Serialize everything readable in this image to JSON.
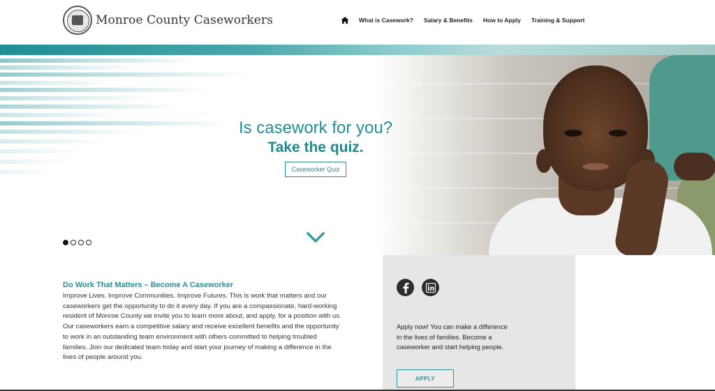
{
  "header": {
    "site_title": "Monroe County Caseworkers",
    "logo_icon": "county-seal-icon",
    "nav": {
      "home_icon": "home-icon",
      "items": [
        {
          "label": "What is Casework?"
        },
        {
          "label": "Salary & Benefits"
        },
        {
          "label": "How to Apply"
        },
        {
          "label": "Training & Support"
        }
      ]
    }
  },
  "hero": {
    "line1": "Is casework for you?",
    "line2": "Take the quiz.",
    "button_label": "Caseworker Quiz",
    "slides_total": 4,
    "active_slide": 1,
    "scroll_icon": "chevron-down-icon"
  },
  "main": {
    "heading": "Do Work That Matters – Become A Caseworker",
    "body": "Improve Lives. Improve Communities. Improve Futures. This is work that matters and our caseworkers get the opportunity to do it every day. If you are a compassionate, hard-working resident of Monroe County we invite you to learn more about, and apply, for a position with us. Our caseworkers earn a competitive salary and receive excellent benefits and the opportunity to work in an outstanding team environment with others committed to helping troubled families. Join our dedicated team today and start your journey of making a difference in the lives of people around you."
  },
  "sidebar": {
    "social": [
      {
        "name": "facebook",
        "icon": "facebook-icon"
      },
      {
        "name": "linkedin",
        "icon": "linkedin-icon"
      }
    ],
    "text": "Apply now! You can make a difference in the lives of families. Become a caseworker and start helping people.",
    "apply_label": "APPLY"
  },
  "colors": {
    "accent": "#2a8f95",
    "sidebar_bg": "#e6e6e6",
    "text": "#333333"
  }
}
